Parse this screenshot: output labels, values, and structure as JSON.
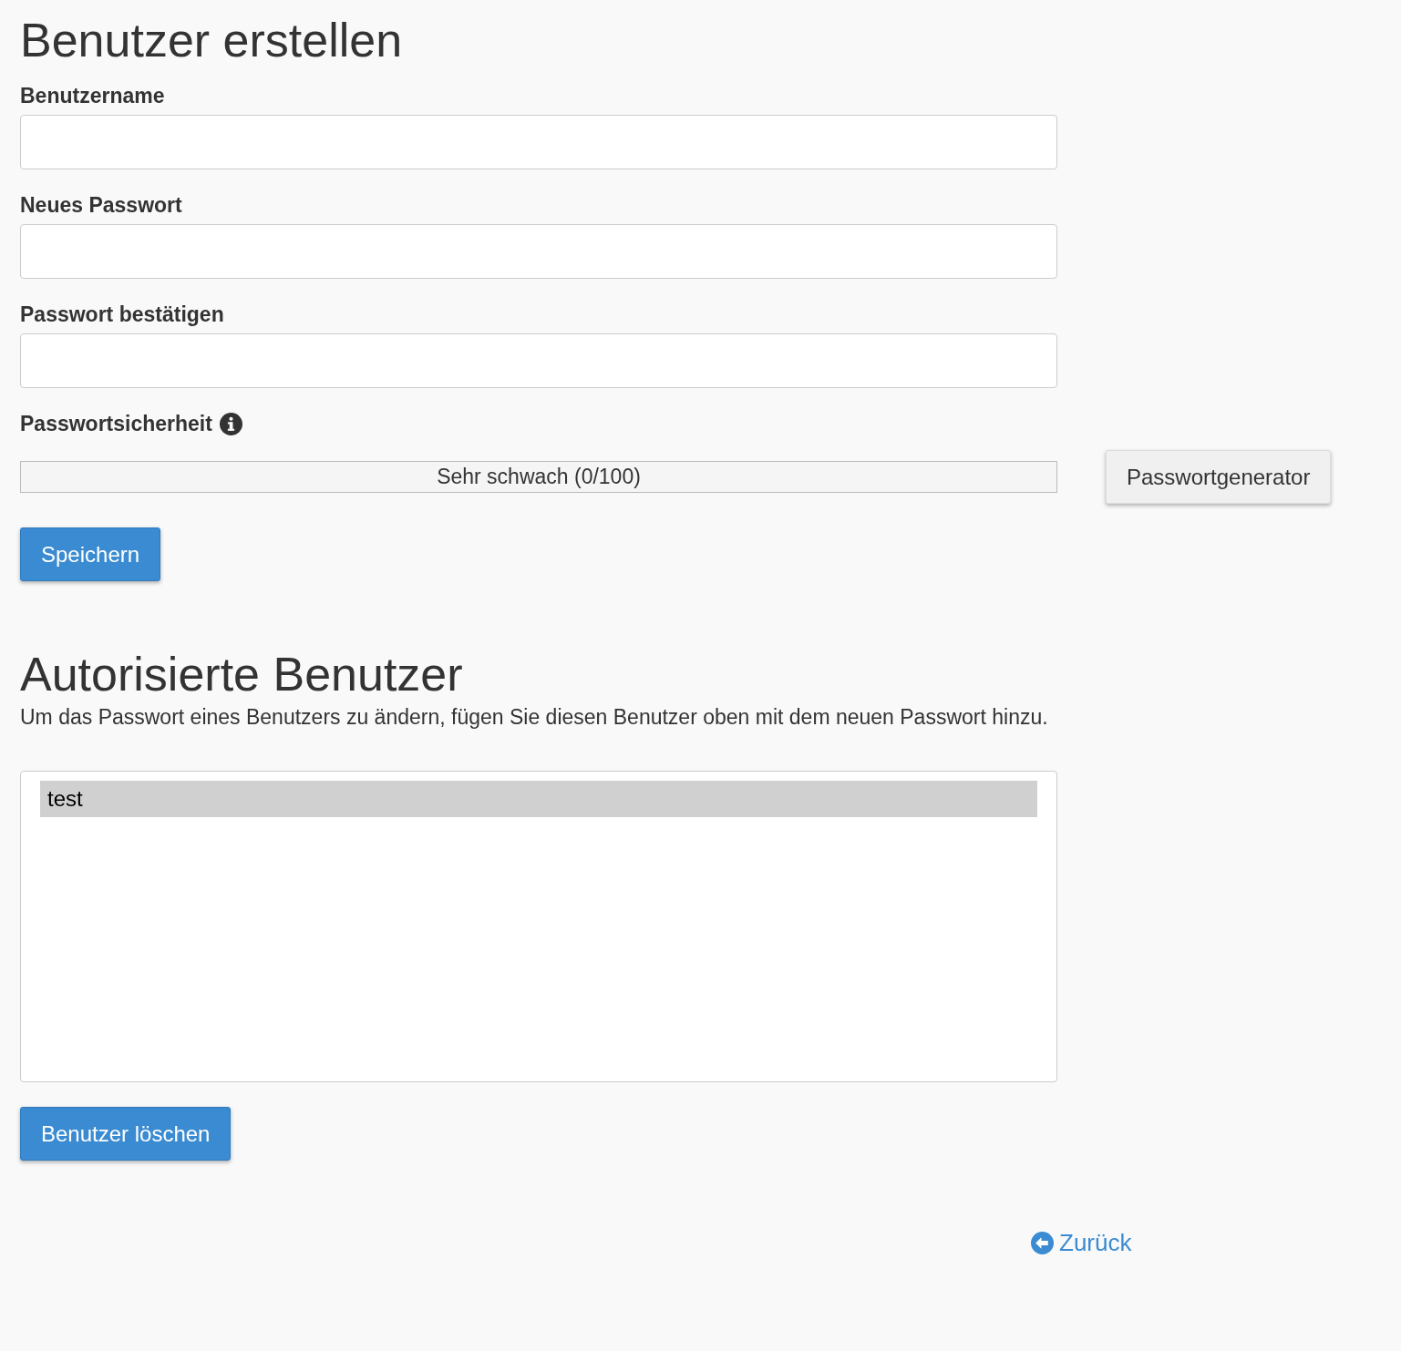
{
  "create_section": {
    "title": "Benutzer erstellen",
    "fields": [
      {
        "label": "Benutzername"
      },
      {
        "label": "Neues Passwort"
      },
      {
        "label": "Passwort bestätigen"
      }
    ],
    "strength": {
      "label": "Passwortsicherheit",
      "level": 0,
      "reading": "Sehr schwach (0/100)"
    },
    "generator_button": "Passwortgenerator",
    "save_button": "Speichern"
  },
  "users_section": {
    "title": "Autorisierte Benutzer",
    "description": "Um das Passwort eines Benutzers zu ändern, fügen Sie diesen Benutzer oben mit dem neuen Passwort hinzu.",
    "users": [
      {
        "name": "test",
        "selected": true
      }
    ],
    "delete_button": "Benutzer löschen"
  },
  "back_link": "Zurück"
}
